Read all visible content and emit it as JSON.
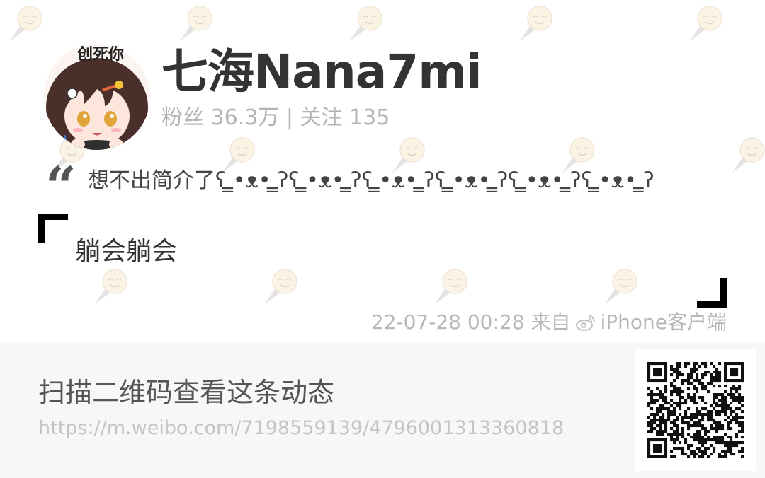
{
  "profile": {
    "username": "七海Nana7mi",
    "stats": "粉丝 36.3万 | 关注 135",
    "avatar_caption": "创死你"
  },
  "bio": {
    "quote_mark": "“",
    "text": "想不出简介了ʕ ̳•ᴥ• ̳ʔʕ ̳•ᴥ• ̳ʔʕ ̳•ᴥ• ̳ʔʕ ̳•ᴥ• ̳ʔʕ ̳•ᴥ• ̳ʔʕ ̳•ᴥ• ̳ʔ"
  },
  "post": {
    "text": "躺会躺会",
    "timestamp": "22-07-28 00:28",
    "from_label": "来自",
    "source": "iPhone客户端",
    "source_icon": "weibo-icon"
  },
  "footer": {
    "scan_label": "扫描二维码查看这条动态",
    "url": "https://m.weibo.com/7198559139/4796001313360818",
    "qr_icon": "qr-code"
  },
  "watermark_icon": "weibo-pin-face-icon",
  "colors": {
    "username": "#333333",
    "muted": "#b3b3b3",
    "footer_bg": "#f7f7f7",
    "bracket": "#000000"
  }
}
